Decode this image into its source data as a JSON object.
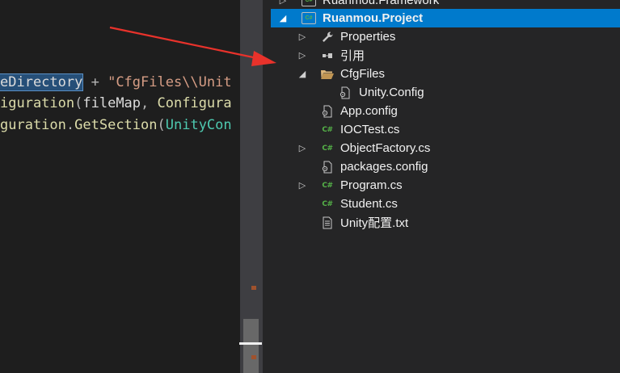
{
  "editor": {
    "lines": [
      {
        "parts": [
          {
            "t": "eDirectory",
            "c": "t-sel"
          },
          {
            "t": " + ",
            "c": "t-punc"
          },
          {
            "t": "\"CfgFiles\\\\Unit",
            "c": "t-str"
          }
        ]
      },
      {
        "parts": [
          {
            "t": "iguration",
            "c": "t-method"
          },
          {
            "t": "(",
            "c": "t-punc"
          },
          {
            "t": "fileMap",
            "c": "t-ident"
          },
          {
            "t": ", ",
            "c": "t-punc"
          },
          {
            "t": "Configura",
            "c": "t-method"
          }
        ]
      },
      {
        "parts": [
          {
            "t": "guration",
            "c": "t-method"
          },
          {
            "t": ".",
            "c": "t-punc"
          },
          {
            "t": "GetSection",
            "c": "t-method"
          },
          {
            "t": "(",
            "c": "t-punc"
          },
          {
            "t": "UnityCon",
            "c": "t-type"
          }
        ]
      }
    ]
  },
  "explorer": {
    "items": [
      {
        "label": "Ruanmou.Framework",
        "icon": "csharp-project-icon",
        "arrow": "collapsed",
        "selected": false,
        "bold": false
      },
      {
        "label": "Ruanmou.Project",
        "icon": "csharp-project-icon",
        "arrow": "expanded",
        "selected": true,
        "bold": true
      },
      {
        "label": "Properties",
        "icon": "wrench-icon",
        "arrow": "collapsed",
        "selected": false,
        "bold": false
      },
      {
        "label": "引用",
        "icon": "references-icon",
        "arrow": "collapsed",
        "selected": false,
        "bold": false
      },
      {
        "label": "CfgFiles",
        "icon": "folder-open-icon",
        "arrow": "expanded",
        "selected": false,
        "bold": false
      },
      {
        "label": "Unity.Config",
        "icon": "config-file-icon",
        "arrow": "none",
        "selected": false,
        "bold": false
      },
      {
        "label": "App.config",
        "icon": "config-file-icon",
        "arrow": "none",
        "selected": false,
        "bold": false
      },
      {
        "label": "IOCTest.cs",
        "icon": "csharp-file-icon",
        "arrow": "none",
        "selected": false,
        "bold": false
      },
      {
        "label": "ObjectFactory.cs",
        "icon": "csharp-file-icon",
        "arrow": "collapsed",
        "selected": false,
        "bold": false
      },
      {
        "label": "packages.config",
        "icon": "config-file-icon",
        "arrow": "none",
        "selected": false,
        "bold": false
      },
      {
        "label": "Program.cs",
        "icon": "csharp-file-icon",
        "arrow": "collapsed",
        "selected": false,
        "bold": false
      },
      {
        "label": "Student.cs",
        "icon": "csharp-file-icon",
        "arrow": "none",
        "selected": false,
        "bold": false
      },
      {
        "label": "Unity配置.txt",
        "icon": "text-file-icon",
        "arrow": "none",
        "selected": false,
        "bold": false
      }
    ]
  },
  "colors": {
    "selection": "#007acc",
    "explorer_bg": "#252526",
    "editor_bg": "#1e1e1e",
    "annotation": "#e8322b",
    "csharp_green": "#55b248"
  }
}
